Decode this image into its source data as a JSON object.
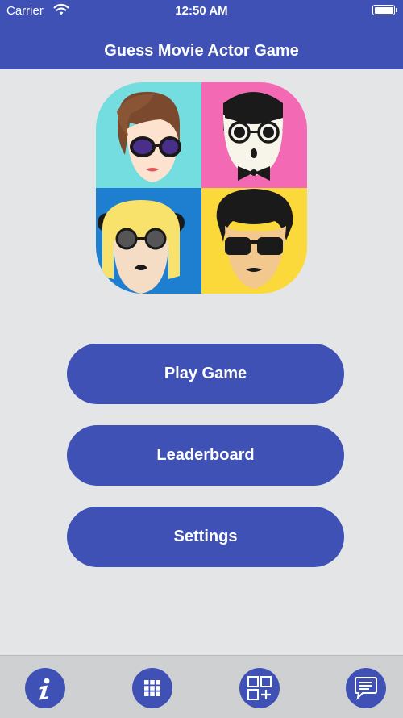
{
  "status_bar": {
    "carrier": "Carrier",
    "time": "12:50 AM"
  },
  "header": {
    "title": "Guess Movie Actor Game"
  },
  "menu": {
    "play_label": "Play Game",
    "leaderboard_label": "Leaderboard",
    "settings_label": "Settings"
  },
  "tabbar": {
    "items": [
      {
        "icon": "info-icon"
      },
      {
        "icon": "grid-icon"
      },
      {
        "icon": "add-apps-icon"
      },
      {
        "icon": "chat-icon"
      }
    ]
  },
  "colors": {
    "primary": "#3f51b5",
    "background": "#e4e5e6",
    "logo_tiles": [
      "#74dde0",
      "#f469b3",
      "#1e7fd0",
      "#fbd93a"
    ]
  }
}
